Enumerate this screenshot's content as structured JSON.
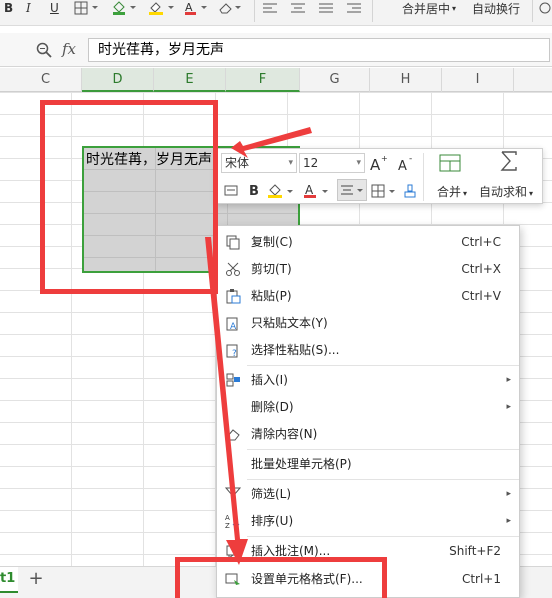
{
  "toolbar": {
    "merge_label": "合并居中",
    "wrap_label": "自动换行"
  },
  "formula_bar": {
    "fx_label": "fx",
    "value": "时光荏苒，岁月无声"
  },
  "columns": [
    "C",
    "D",
    "E",
    "F",
    "G",
    "H",
    "I"
  ],
  "cell": {
    "text": "时光荏苒，岁月无声"
  },
  "mini_toolbar": {
    "font_name": "宋体",
    "font_size": "12",
    "bold_label": "B",
    "merge_label": "合并",
    "autosum_label": "自动求和"
  },
  "context_menu": {
    "items": [
      {
        "label": "复制(C)",
        "shortcut": "Ctrl+C",
        "icon": "copy-icon"
      },
      {
        "label": "剪切(T)",
        "shortcut": "Ctrl+X",
        "icon": "scissors-icon"
      },
      {
        "label": "粘贴(P)",
        "shortcut": "Ctrl+V",
        "icon": "paste-icon"
      },
      {
        "label": "只粘贴文本(Y)",
        "shortcut": "",
        "icon": "paste-text-icon"
      },
      {
        "label": "选择性粘贴(S)...",
        "shortcut": "",
        "icon": "paste-special-icon"
      },
      {
        "label": "插入(I)",
        "shortcut": "",
        "icon": "insert-icon"
      },
      {
        "label": "删除(D)",
        "shortcut": "",
        "icon": ""
      },
      {
        "label": "清除内容(N)",
        "shortcut": "",
        "icon": "eraser-icon"
      },
      {
        "label": "批量处理单元格(P)",
        "shortcut": "",
        "icon": ""
      },
      {
        "label": "筛选(L)",
        "shortcut": "",
        "icon": "filter-icon"
      },
      {
        "label": "排序(U)",
        "shortcut": "",
        "icon": "sort-az-icon"
      },
      {
        "label": "插入批注(M)...",
        "shortcut": "Shift+F2",
        "icon": "comment-icon"
      },
      {
        "label": "设置单元格格式(F)...",
        "shortcut": "Ctrl+1",
        "icon": "format-cells-icon"
      }
    ]
  },
  "sheet_bar": {
    "tab_label": "t1",
    "add_label": "+"
  },
  "colors": {
    "accent_green": "#3ca03c",
    "annotation_red": "#ee3d3d"
  }
}
